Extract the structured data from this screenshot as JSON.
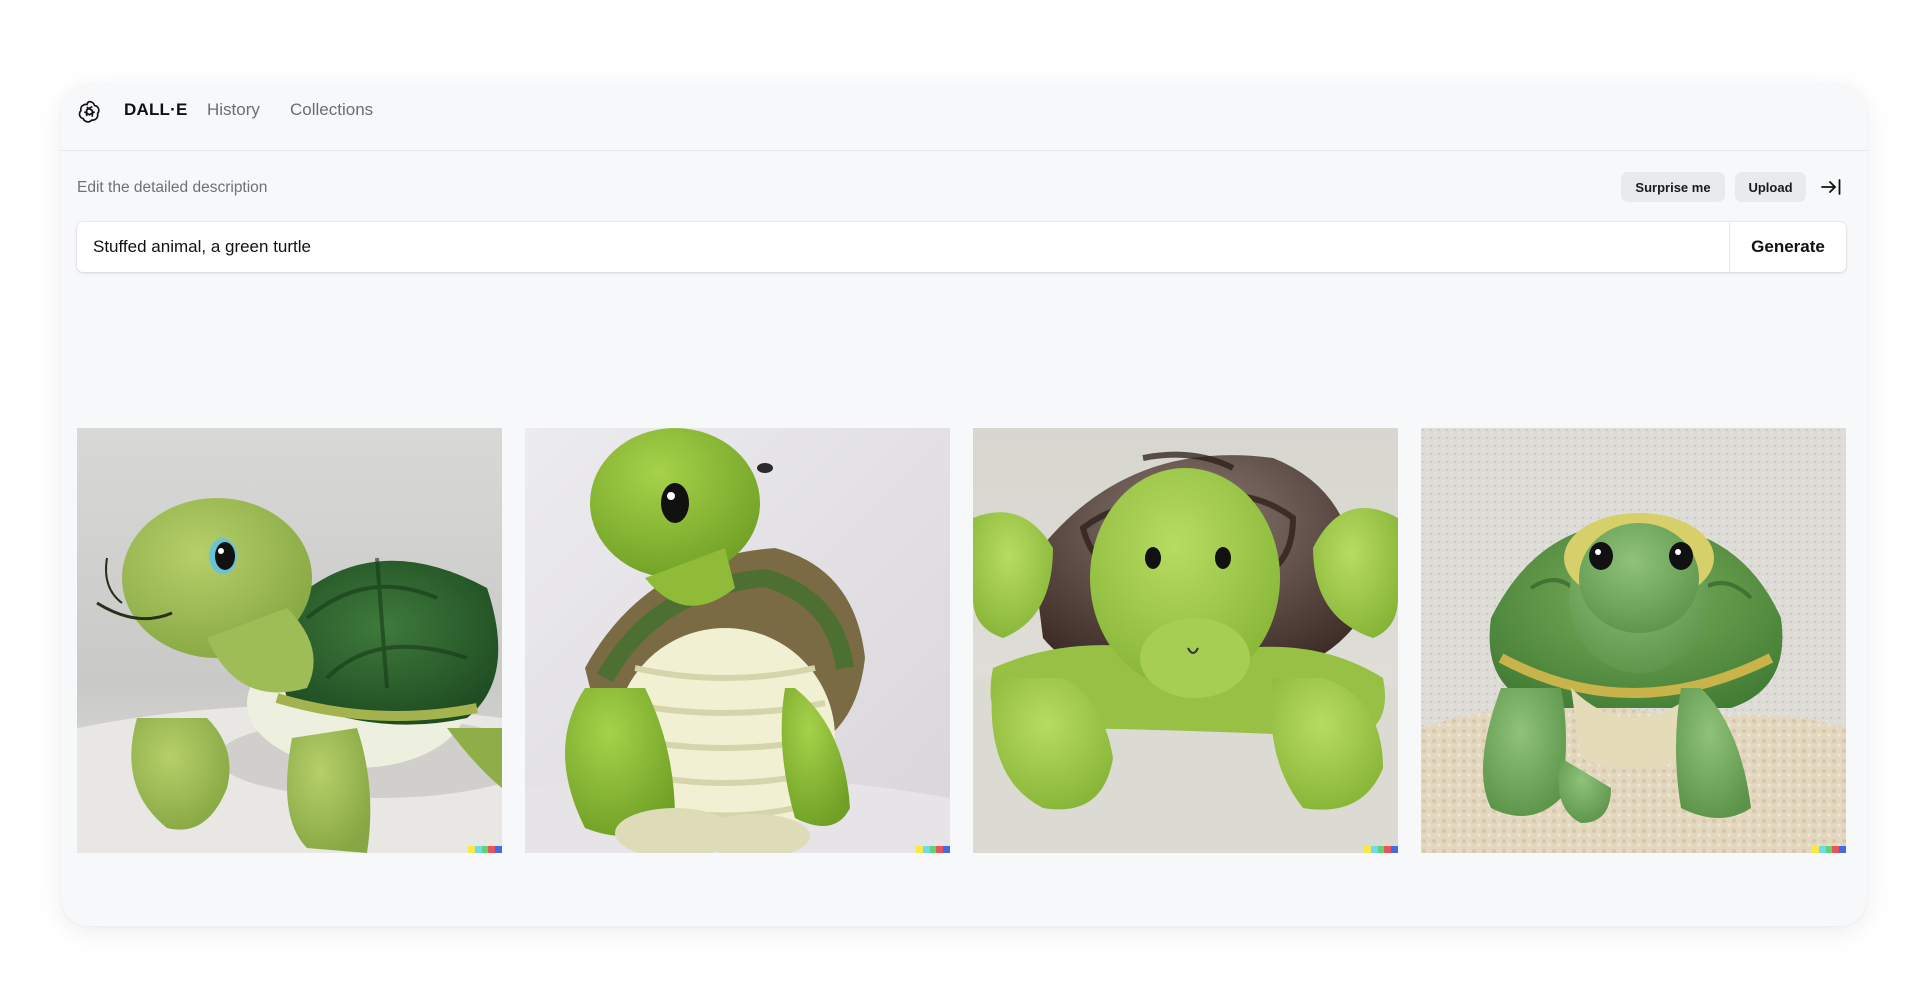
{
  "nav": {
    "brand": "DALL·E",
    "history": "History",
    "collections": "Collections",
    "logo_icon": "openai-logo-icon"
  },
  "prompt": {
    "label": "Edit the detailed description",
    "value": "Stuffed animal, a green turtle",
    "generate_label": "Generate"
  },
  "actions": {
    "surprise_label": "Surprise me",
    "upload_label": "Upload",
    "collapse_icon": "collapse-panel-icon"
  },
  "gallery": {
    "images": [
      {
        "subject": "green plush turtle, side view, dark green shell"
      },
      {
        "subject": "green plush turtle sitting upright, cream ribbed belly"
      },
      {
        "subject": "green plush turtle front view on blanket, brown shell"
      },
      {
        "subject": "green plush turtle on beige fluffy rug, yellow-rimmed eyes"
      }
    ],
    "signature_colors": [
      "#f7e94a",
      "#6fd9f0",
      "#5ed36f",
      "#e9555a",
      "#3d6ee8"
    ]
  }
}
